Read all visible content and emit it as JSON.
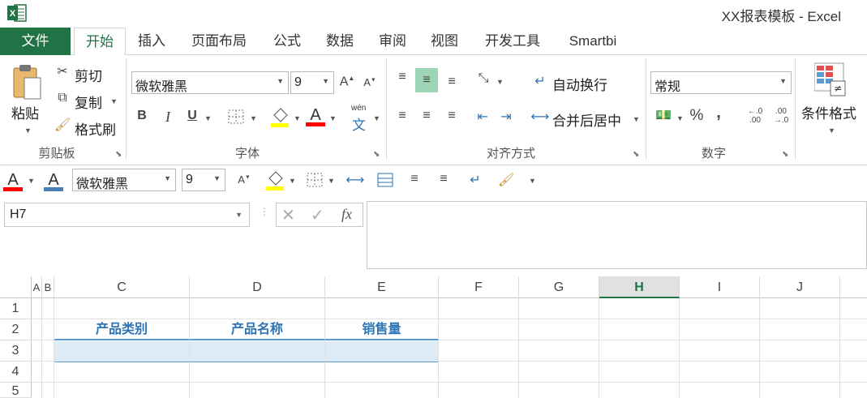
{
  "title_bar": {
    "document_title": "XX报表模板 - Excel",
    "app_icon": "excel-logo-icon"
  },
  "tabs": [
    {
      "label": "文件"
    },
    {
      "label": "开始"
    },
    {
      "label": "插入"
    },
    {
      "label": "页面布局"
    },
    {
      "label": "公式"
    },
    {
      "label": "数据"
    },
    {
      "label": "审阅"
    },
    {
      "label": "视图"
    },
    {
      "label": "开发工具"
    },
    {
      "label": "Smartbi"
    }
  ],
  "ribbon": {
    "clipboard": {
      "paste": "粘贴",
      "cut": "剪切",
      "copy": "复制",
      "format_painter": "格式刷",
      "group": "剪贴板"
    },
    "font": {
      "name": "微软雅黑",
      "size": "9",
      "group": "字体",
      "bold": "B",
      "italic": "I",
      "underline": "U",
      "phonetic": "wén",
      "phonetic_char": "文"
    },
    "alignment": {
      "wrap": "自动换行",
      "merge": "合并后居中",
      "group": "对齐方式"
    },
    "number": {
      "format": "常规",
      "percent": "%",
      "comma": ",",
      "group": "数字"
    },
    "styles": {
      "conditional": "条件格式"
    }
  },
  "mini_toolbar": {
    "font_name": "微软雅黑",
    "font_size": "9"
  },
  "formula_bar": {
    "name_box": "H7",
    "fx": "fx"
  },
  "grid": {
    "columns": [
      "A",
      "B",
      "C",
      "D",
      "E",
      "F",
      "G",
      "H",
      "I",
      "J"
    ],
    "selected_column": "H",
    "rows": [
      "1",
      "2",
      "3",
      "4",
      "5"
    ],
    "headers": [
      "产品类别",
      "产品名称",
      "销售量"
    ]
  },
  "colors": {
    "excel_green": "#217346",
    "header_blue": "#2e75b6",
    "band_blue": "#ddebf7",
    "fill_yellow": "#ffff00",
    "font_red": "#ff0000"
  }
}
